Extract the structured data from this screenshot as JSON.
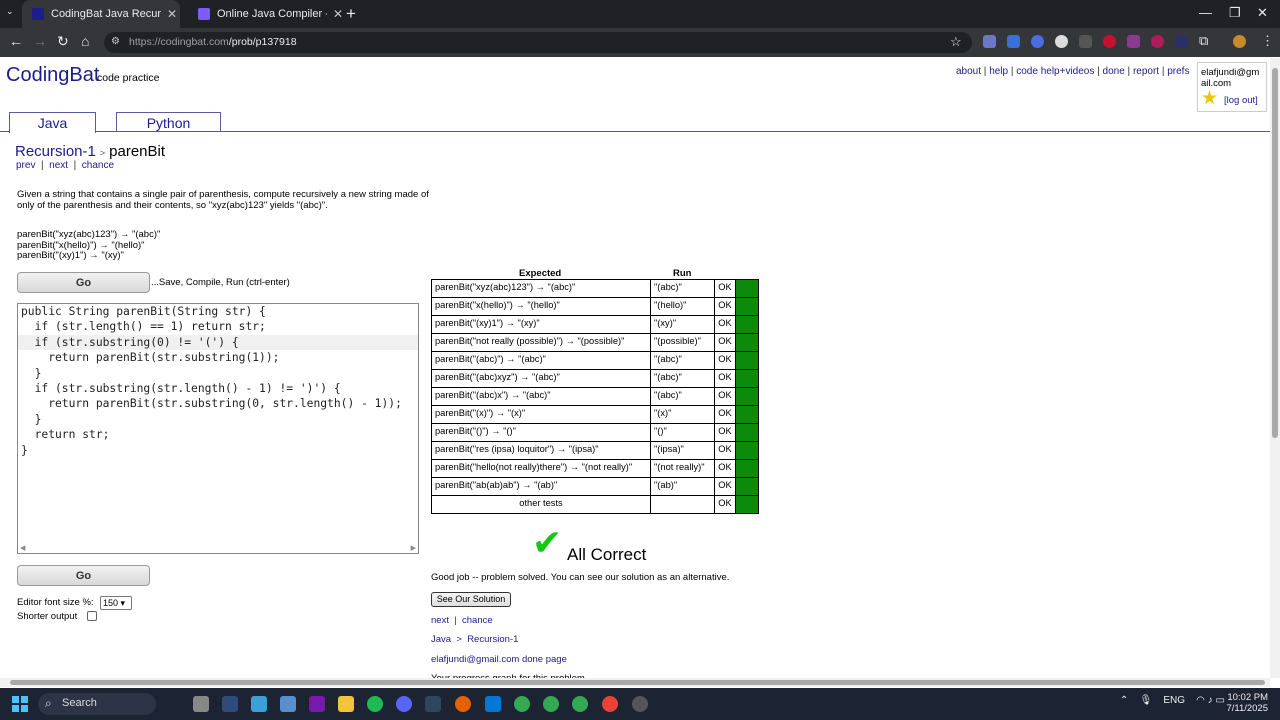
{
  "browser": {
    "tabs": [
      {
        "title": "CodingBat Java Recursion-1 pa...",
        "active": true
      },
      {
        "title": "Online Java Compiler - Program...",
        "active": false
      }
    ],
    "url_host": "https://codingbat.com",
    "url_path": "/prob/p137918"
  },
  "site": {
    "logo": "CodingBat",
    "logo_sub": "code practice",
    "top_links": [
      "about",
      "help",
      "code help+videos",
      "done",
      "report",
      "prefs"
    ],
    "user_email": "elafjundi@gmail.com",
    "logout": "[log out]",
    "lang_tabs": [
      "Java",
      "Python"
    ]
  },
  "problem": {
    "section": "Recursion-1",
    "name": "parenBit",
    "nav": [
      "prev",
      "next",
      "chance"
    ],
    "description": "Given a string that contains a single pair of parenthesis, compute recursively a new string made of only of the parenthesis and their contents, so \"xyz(abc)123\" yields \"(abc)\".",
    "examples": [
      "parenBit(\"xyz(abc)123\") → \"(abc)\"",
      "parenBit(\"x(hello)\") → \"(hello)\"",
      "parenBit(\"(xy)1\") → \"(xy)\""
    ],
    "go_label": "Go",
    "go_hint": "...Save, Compile, Run (ctrl-enter)",
    "editor_font_label": "Editor font size %:",
    "editor_font_value": "150",
    "shorter_output_label": "Shorter output"
  },
  "code_lines": [
    "public String parenBit(String str) {",
    "  if (str.length() == 1) return str;",
    "  if (str.substring(0) != '(') {",
    "    return parenBit(str.substring(1));",
    "  }",
    "  if (str.substring(str.length() - 1) != ')') {",
    "    return parenBit(str.substring(0, str.length() - 1));",
    "  }",
    "  return str;",
    "}"
  ],
  "results": {
    "headers": {
      "expected": "Expected",
      "run": "Run"
    },
    "rows": [
      {
        "expected": "parenBit(\"xyz(abc)123\") → \"(abc)\"",
        "run": "\"(abc)\"",
        "status": "OK"
      },
      {
        "expected": "parenBit(\"x(hello)\") → \"(hello)\"",
        "run": "\"(hello)\"",
        "status": "OK"
      },
      {
        "expected": "parenBit(\"(xy)1\") → \"(xy)\"",
        "run": "\"(xy)\"",
        "status": "OK"
      },
      {
        "expected": "parenBit(\"not really (possible)\") → \"(possible)\"",
        "run": "\"(possible)\"",
        "status": "OK"
      },
      {
        "expected": "parenBit(\"(abc)\") → \"(abc)\"",
        "run": "\"(abc)\"",
        "status": "OK"
      },
      {
        "expected": "parenBit(\"(abc)xyz\") → \"(abc)\"",
        "run": "\"(abc)\"",
        "status": "OK"
      },
      {
        "expected": "parenBit(\"(abc)x\") → \"(abc)\"",
        "run": "\"(abc)\"",
        "status": "OK"
      },
      {
        "expected": "parenBit(\"(x)\") → \"(x)\"",
        "run": "\"(x)\"",
        "status": "OK"
      },
      {
        "expected": "parenBit(\"()\") → \"()\"",
        "run": "\"()\"",
        "status": "OK"
      },
      {
        "expected": "parenBit(\"res (ipsa) loquitor\") → \"(ipsa)\"",
        "run": "\"(ipsa)\"",
        "status": "OK"
      },
      {
        "expected": "parenBit(\"hello(not really)there\") → \"(not really)\"",
        "run": "\"(not really)\"",
        "status": "OK"
      },
      {
        "expected": "parenBit(\"ab(ab)ab\") → \"(ab)\"",
        "run": "\"(ab)\"",
        "status": "OK"
      },
      {
        "expected": "other tests",
        "run": "",
        "status": "OK"
      }
    ],
    "pass_color": "#0b8a0b",
    "all_correct": "All Correct",
    "good_job": "Good job -- problem solved. You can see our solution as an alternative.",
    "see_solution": "See Our Solution",
    "bottom_nav": [
      "next",
      "chance"
    ],
    "bottom_crumb": [
      "Java",
      "Recursion-1"
    ],
    "done_page": "elafjundi@gmail.com done page",
    "progress_text": "Your progress graph for this problem"
  },
  "taskbar": {
    "search_placeholder": "Search",
    "lang": "ENG",
    "time": "10:02 PM",
    "date": "7/11/2025"
  }
}
